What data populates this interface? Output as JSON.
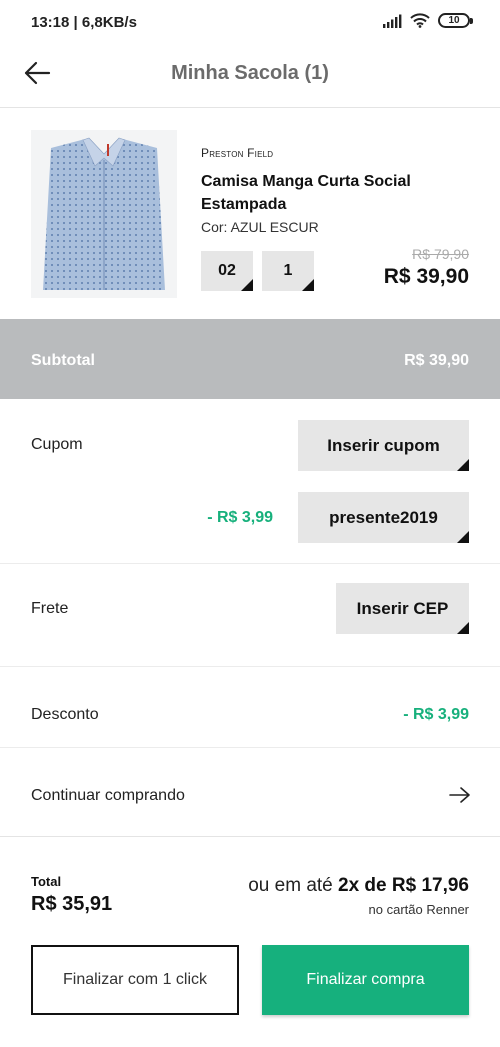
{
  "status_bar": {
    "time_speed": "13:18 | 6,8KB/s",
    "battery": "10",
    "icons": [
      "signal-icon",
      "wifi-icon",
      "battery-icon"
    ]
  },
  "header": {
    "title": "Minha Sacola (1)",
    "back_icon": "arrow-left-icon"
  },
  "product": {
    "brand": "Preston Field",
    "name": "Camisa Manga Curta Social Estampada",
    "color": "Cor: AZUL ESCUR",
    "size": "02",
    "quantity": "1",
    "old_price": "R$ 79,90",
    "price": "R$ 39,90"
  },
  "subtotal": {
    "label": "Subtotal",
    "value": "R$ 39,90"
  },
  "coupon": {
    "label": "Cupom",
    "button": "Inserir cupom",
    "applied_discount": "- R$ 3,99",
    "applied_code": "presente2019"
  },
  "shipping": {
    "label": "Frete",
    "button": "Inserir CEP"
  },
  "discount": {
    "label": "Desconto",
    "value": "- R$ 3,99"
  },
  "continue": {
    "label": "Continuar comprando",
    "icon": "arrow-right-icon"
  },
  "total": {
    "label": "Total",
    "value": "R$ 35,91",
    "installment_prefix": "ou em até ",
    "installment_value": "2x de R$ 17,96",
    "card_note": "no cartão Renner"
  },
  "actions": {
    "one_click": "Finalizar com 1 click",
    "checkout": "Finalizar compra"
  },
  "colors": {
    "accent_green": "#16b07d",
    "subtotal_bg": "#b9bbbd",
    "button_gray": "#e6e6e6"
  }
}
